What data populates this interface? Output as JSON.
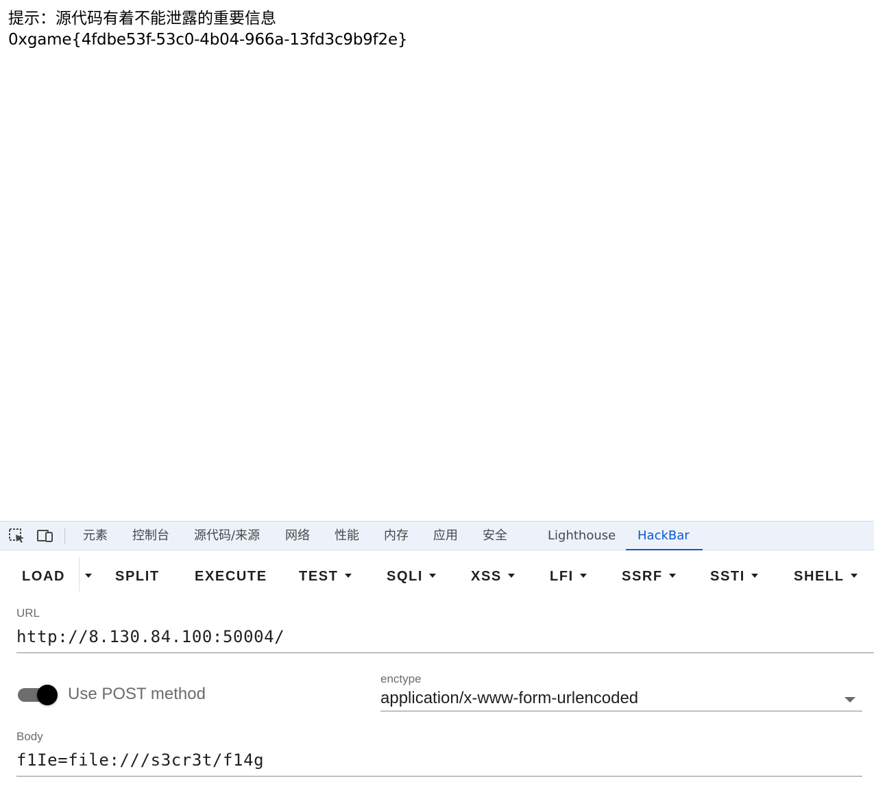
{
  "page": {
    "hint_text": "提示：源代码有着不能泄露的重要信息",
    "flag_text": "0xgame{4fdbe53f-53c0-4b04-966a-13fd3c9b9f2e}"
  },
  "devtools": {
    "tabs": [
      {
        "label": "元素"
      },
      {
        "label": "控制台"
      },
      {
        "label": "源代码/来源"
      },
      {
        "label": "网络"
      },
      {
        "label": "性能"
      },
      {
        "label": "内存"
      },
      {
        "label": "应用"
      },
      {
        "label": "安全"
      },
      {
        "label": "Lighthouse"
      },
      {
        "label": "HackBar",
        "active": true
      }
    ],
    "icons": [
      "inspect-element-icon",
      "device-toolbar-icon"
    ]
  },
  "hackbar": {
    "toolbar": {
      "load": "LOAD",
      "split": "SPLIT",
      "execute": "EXECUTE",
      "test": "TEST",
      "sqli": "SQLI",
      "xss": "XSS",
      "lfi": "LFI",
      "ssrf": "SSRF",
      "ssti": "SSTI",
      "shell": "SHELL"
    },
    "url": {
      "label": "URL",
      "value": "http://8.130.84.100:50004/"
    },
    "post": {
      "label": "Use POST method",
      "enabled": true
    },
    "enctype": {
      "label": "enctype",
      "value": "application/x-www-form-urlencoded"
    },
    "body": {
      "label": "Body",
      "value": "f1Ie=file:///s3cr3t/f14g"
    }
  },
  "colors": {
    "accent": "#0b57d0",
    "tabbar_bg": "#edf2fa",
    "toggle_knob": "#000000",
    "toggle_track": "#6d6d6d"
  }
}
